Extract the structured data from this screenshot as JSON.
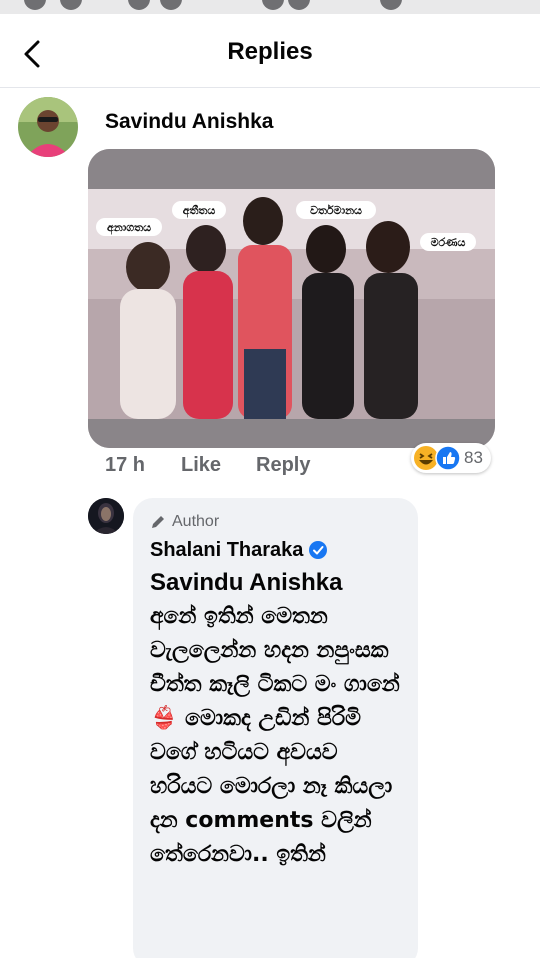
{
  "header": {
    "title": "Replies"
  },
  "reply": {
    "author": "Savindu Anishka",
    "photo_labels": [
      "අනාගතය",
      "අතීතය",
      "වර්තමානය",
      "මරණය"
    ],
    "time": "17 h",
    "like_label": "Like",
    "reply_label": "Reply",
    "reaction_count": "83"
  },
  "author_reply": {
    "badge": "Author",
    "name": "Shalani Tharaka",
    "mention": "Savindu Anishka",
    "text": "අනේ ඉතින් මෙතන වැලලෙන්න හදන නපුංසක චීත්ත කෑලි ටිකට මං ගානේ 👙 මොකද උඩින් පිරිමි වගේ හටියට අවයව හරියට මොරලා නෑ කියලා දන comments වලින් තේරෙනවා.. ඉතින්"
  },
  "colors": {
    "accent": "#1877f2",
    "secondary_text": "#65676b",
    "bubble": "#f0f2f5"
  }
}
